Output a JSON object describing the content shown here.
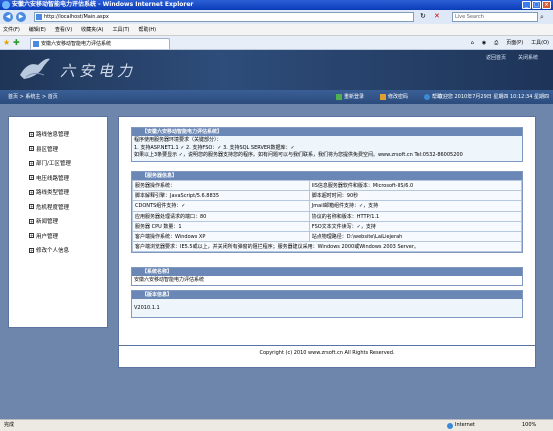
{
  "window": {
    "title": "安徽六安移动智能电力评估系统 - Windows Internet Explorer"
  },
  "addressbar": {
    "url": "http://localhost/Main.aspx",
    "search_placeholder": "Live Search"
  },
  "menubar": {
    "items": [
      "文件(F)",
      "编辑(E)",
      "查看(V)",
      "收藏夹(A)",
      "工具(T)",
      "帮助(H)"
    ]
  },
  "tabbar": {
    "tab_title": "安徽六安移动智能电力评估系统",
    "tools": [
      "页面(P)",
      "工具(O)"
    ]
  },
  "header": {
    "logo_text": "六安电力",
    "links": [
      "返回首页",
      "关闭系统"
    ]
  },
  "crumbbar": {
    "breadcrumb": "首页 > 系统主 > 首页",
    "actions": [
      "重新登录",
      "修改密码",
      "帮助"
    ],
    "welcome": "欢迎您 2010年7月29日 星期四 10:12:34 星期四"
  },
  "sidebar": {
    "items": [
      "路线信息管理",
      "县区管理",
      "部门/工区管理",
      "电压线路管理",
      "路线类型管理",
      "危机程度管理",
      "新闻管理",
      "用户管理",
      "修改个人信息"
    ]
  },
  "intro": {
    "title": "【安徽六安移动智能电力评估系统】",
    "lines": [
      "程序使用服务器环境要求（关键部分）：",
      "1. 支持ASP.NET1.1 ✓  2. 支持FSO：✓  3. 支持SQL SERVER数据库：✓",
      "如果以上3条要显示 ✓，说明您的服务器支持您的程序。如有问题可以与我们联系，我们将为您提供免费空间。www.zrsoft.cn Tel:0532-86005200"
    ]
  },
  "server": {
    "title": "【服务器信息】",
    "rows": [
      [
        "服务器操作系统：",
        "IIS信息服务器软件和版本：Microsoft-IIS/6.0"
      ],
      [
        "脚本解释引擎：JavaScript/5.6.8835",
        "脚本超时时间：90秒"
      ],
      [
        "CDONTS组件支持：✓",
        "Jmail邮箱组件支持：✓，支持"
      ],
      [
        "应用服务器处理请求的端口：80",
        "协议的名称和版本：HTTP/1.1"
      ],
      [
        "服务器 CPU 数量：1",
        "FSO文本文件读写：✓，支持"
      ],
      [
        "客户端操作系统：Windows XP",
        "站点物理路径：D:\\website\\LaiLiejerah"
      ],
      [
        "客户端浏览器要求：IE5.5或以上，并关闭所有弹窗的阻拦程序；服务器建议采用：Windows 2000或Windows 2003 Server。",
        ""
      ]
    ]
  },
  "about": {
    "title": "【系统名称】",
    "text": "安徽六安移动智能电力评估系统"
  },
  "version": {
    "title": "【版本信息】",
    "text": "V2010.1.1"
  },
  "footer": {
    "copyright": "Copyright (c) 2010 www.zrsoft.cn All Rights Reserved."
  },
  "statusbar": {
    "status": "完成",
    "zone": "Internet",
    "zoom": "100%"
  }
}
